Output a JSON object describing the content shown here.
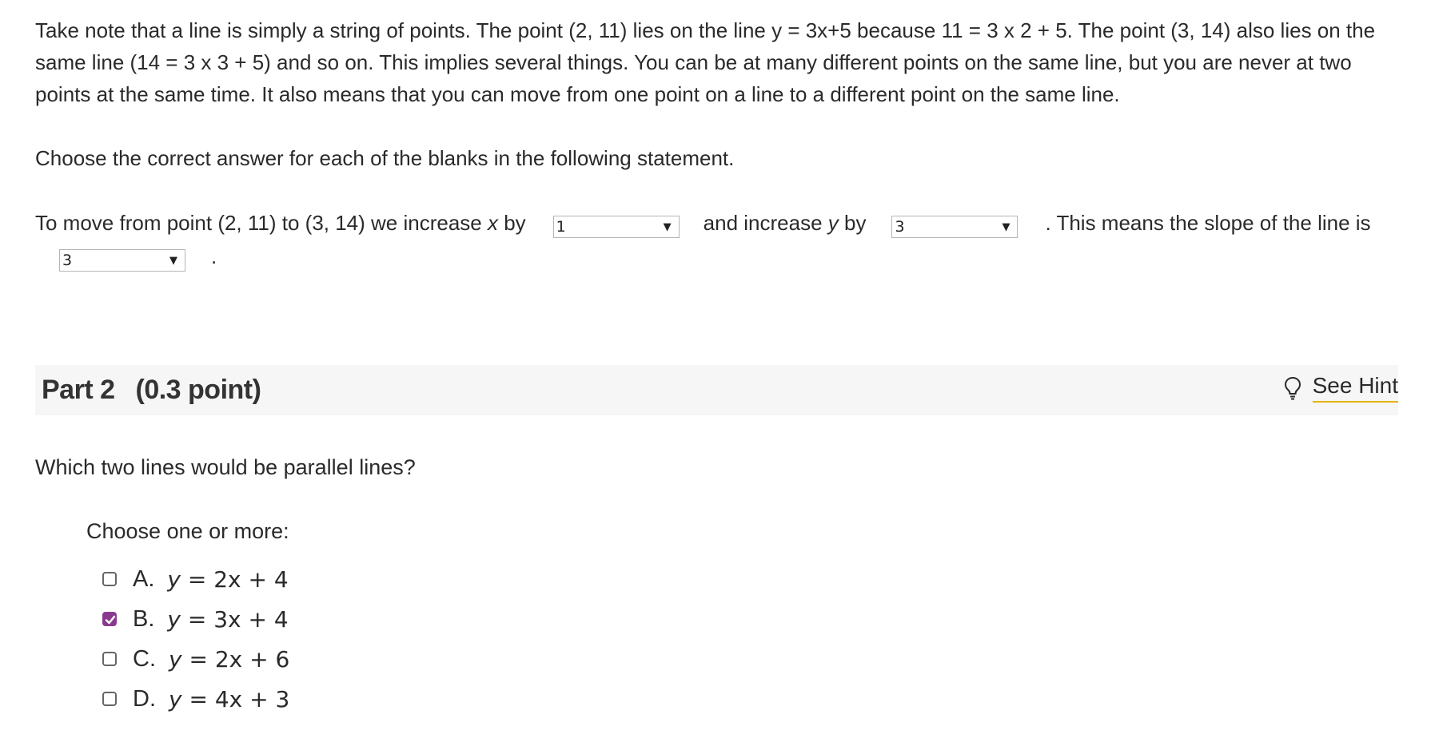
{
  "intro": {
    "text": "Take note that a line is simply a string of points. The point (2, 11) lies on the line y = 3x+5 because 11 = 3 x 2 + 5. The point (3, 14) also lies on the same line (14 = 3 x 3 + 5) and so on. This implies several things. You can be at many different points on the same line, but you are never at two points at the same time. It also means that you can move from one point on a line to a different point on the same line."
  },
  "instruction": "Choose the correct answer for each of the blanks in the following statement.",
  "statement": {
    "part1": "To move from point (2, 11) to (3, 14) we increase ",
    "var_x": "x",
    "part2": " by",
    "select1": "1",
    "part3": "and increase ",
    "var_y": "y",
    "part4": " by",
    "select2": "3",
    "part5": ". This means the slope of the line is",
    "select3": "3",
    "part6": "."
  },
  "part2": {
    "label": "Part 2",
    "points": "(0.3 point)",
    "hint_label": "See Hint",
    "question": "Which two lines would be parallel lines?",
    "choose_label": "Choose one or more:",
    "options": [
      {
        "letter": "A.",
        "expr_lhs": "y",
        "expr_rhs": " = 2x + 4",
        "checked": false
      },
      {
        "letter": "B.",
        "expr_lhs": "y",
        "expr_rhs": " = 3x + 4",
        "checked": true
      },
      {
        "letter": "C.",
        "expr_lhs": "y",
        "expr_rhs": " = 2x + 6",
        "checked": false
      },
      {
        "letter": "D.",
        "expr_lhs": "y",
        "expr_rhs": " = 4x + 3",
        "checked": false
      }
    ]
  },
  "colors": {
    "accent_checked": "#8a3a8e",
    "hint_underline": "#e3b505",
    "header_bg": "#f6f6f6"
  },
  "icons": {
    "hint": "lightbulb-icon",
    "dropdown": "triangle-down-icon",
    "check": "checkmark-icon"
  }
}
